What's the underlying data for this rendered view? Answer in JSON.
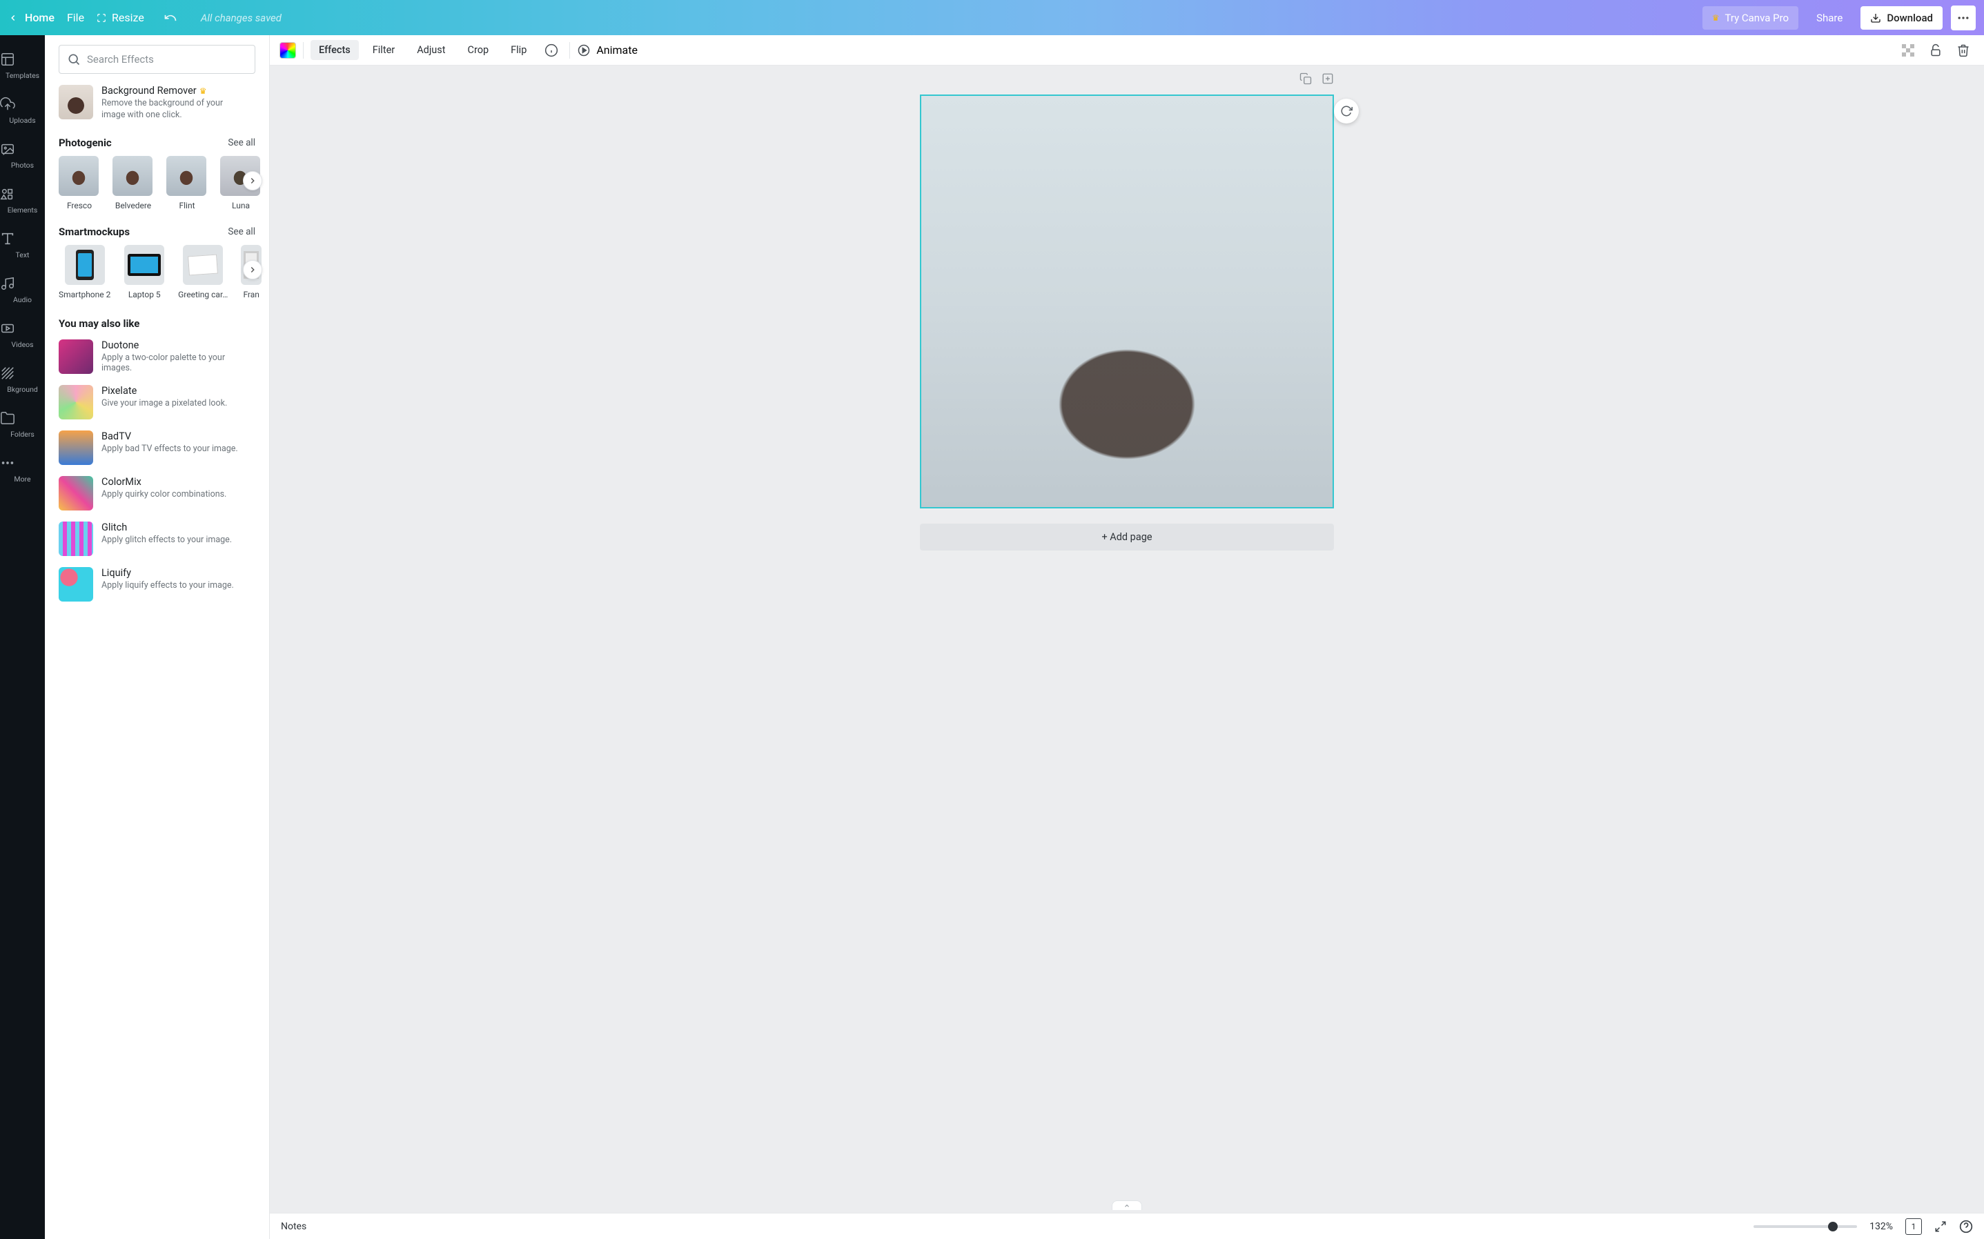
{
  "header": {
    "home": "Home",
    "file": "File",
    "resize": "Resize",
    "saved_status": "All changes saved",
    "try_pro": "Try Canva Pro",
    "share": "Share",
    "download": "Download"
  },
  "rail": {
    "templates": "Templates",
    "uploads": "Uploads",
    "photos": "Photos",
    "elements": "Elements",
    "text": "Text",
    "audio": "Audio",
    "videos": "Videos",
    "bkground": "Bkground",
    "folders": "Folders",
    "more": "More"
  },
  "panel": {
    "search_placeholder": "Search Effects",
    "bg_remover_title": "Background Remover",
    "bg_remover_desc": "Remove the background of your image with one click.",
    "photogenic_heading": "Photogenic",
    "see_all": "See all",
    "photogenic": [
      "Fresco",
      "Belvedere",
      "Flint",
      "Luna"
    ],
    "smartmockups_heading": "Smartmockups",
    "smartmockups": [
      "Smartphone 2",
      "Laptop 5",
      "Greeting car…",
      "Fran"
    ],
    "ymal_heading": "You may also like",
    "ymal": [
      {
        "name": "Duotone",
        "desc": "Apply a two-color palette to your images.",
        "sw": "sw-duotone"
      },
      {
        "name": "Pixelate",
        "desc": "Give your image a pixelated look.",
        "sw": "sw-pixelate"
      },
      {
        "name": "BadTV",
        "desc": "Apply bad TV effects to your image.",
        "sw": "sw-badtv"
      },
      {
        "name": "ColorMix",
        "desc": "Apply quirky color combinations.",
        "sw": "sw-colormix"
      },
      {
        "name": "Glitch",
        "desc": "Apply glitch effects to your image.",
        "sw": "sw-glitch"
      },
      {
        "name": "Liquify",
        "desc": "Apply liquify effects to your image.",
        "sw": "sw-liquify"
      }
    ]
  },
  "toolbar": {
    "effects": "Effects",
    "filter": "Filter",
    "adjust": "Adjust",
    "crop": "Crop",
    "flip": "Flip",
    "animate": "Animate"
  },
  "canvas": {
    "add_page": "+ Add page"
  },
  "bottombar": {
    "notes": "Notes",
    "zoom": "132%",
    "page_current": "1"
  }
}
